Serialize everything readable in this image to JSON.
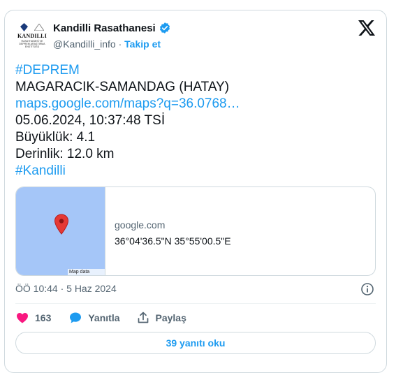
{
  "author": {
    "logo_title": "KANDILLI",
    "logo_subtitle": "RASATHANESİ VE DEPREM ARAŞTIRMA ENSTİTÜSÜ",
    "name": "Kandilli Rasathanesi",
    "handle": "@Kandilli_info",
    "separator": " · ",
    "follow_label": "Takip et"
  },
  "tweet": {
    "lines": [
      "#DEPREM",
      "MAGARACIK-SAMANDAG (HATAY)",
      "maps.google.com/maps?q=36.0768…",
      "05.06.2024, 10:37:48 TSİ",
      "Büyüklük: 4.1",
      "Derinlik: 12.0 km",
      "#Kandilli"
    ]
  },
  "link_card": {
    "map_credit": "Map data ©2024",
    "domain": "google.com",
    "coordinates": "36°04'36.5\"N 35°55'00.5\"E"
  },
  "meta": {
    "timestamp": "ÖÖ 10:44 · 5 Haz 2024"
  },
  "actions": {
    "like_count": "163",
    "reply_label": "Yanıtla",
    "share_label": "Paylaş"
  },
  "read_replies_label": "39 yanıtı oku",
  "colors": {
    "accent": "#1d9bf0",
    "like": "#f91880",
    "muted": "#536471",
    "map_water": "#a5c6f8"
  },
  "icons": [
    "verified-badge-icon",
    "x-logo-icon",
    "map-pin-icon",
    "info-icon",
    "heart-icon",
    "reply-bubble-icon",
    "share-icon"
  ]
}
